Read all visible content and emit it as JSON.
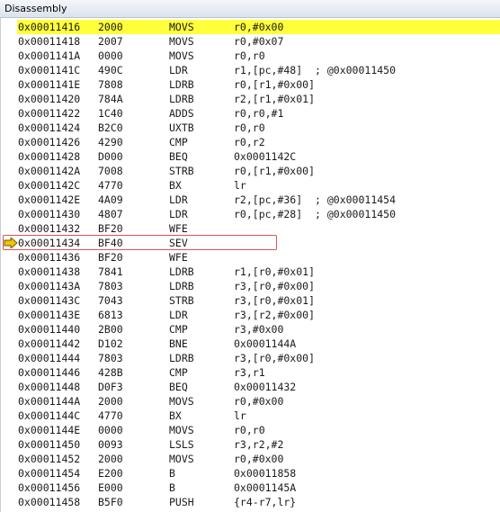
{
  "window": {
    "title": "Disassembly"
  },
  "colors": {
    "current_line_highlight": "#ffff3b",
    "current_instruction_box": "#e0505a",
    "execution_arrow": "#f2c400"
  },
  "current_instruction_icon": "yellow-arrow-icon",
  "rows": [
    {
      "addr": "0x00011416",
      "opcode": "2000",
      "mnemonic": "MOVS",
      "operands": "r0,#0x00"
    },
    {
      "addr": "0x00011418",
      "opcode": "2007",
      "mnemonic": "MOVS",
      "operands": "r0,#0x07"
    },
    {
      "addr": "0x0001141A",
      "opcode": "0000",
      "mnemonic": "MOVS",
      "operands": "r0,r0"
    },
    {
      "addr": "0x0001141C",
      "opcode": "490C",
      "mnemonic": "LDR",
      "operands": "r1,[pc,#48]  ; @0x00011450"
    },
    {
      "addr": "0x0001141E",
      "opcode": "7808",
      "mnemonic": "LDRB",
      "operands": "r0,[r1,#0x00]"
    },
    {
      "addr": "0x00011420",
      "opcode": "784A",
      "mnemonic": "LDRB",
      "operands": "r2,[r1,#0x01]"
    },
    {
      "addr": "0x00011422",
      "opcode": "1C40",
      "mnemonic": "ADDS",
      "operands": "r0,r0,#1"
    },
    {
      "addr": "0x00011424",
      "opcode": "B2C0",
      "mnemonic": "UXTB",
      "operands": "r0,r0"
    },
    {
      "addr": "0x00011426",
      "opcode": "4290",
      "mnemonic": "CMP",
      "operands": "r0,r2"
    },
    {
      "addr": "0x00011428",
      "opcode": "D000",
      "mnemonic": "BEQ",
      "operands": "0x0001142C"
    },
    {
      "addr": "0x0001142A",
      "opcode": "7008",
      "mnemonic": "STRB",
      "operands": "r0,[r1,#0x00]"
    },
    {
      "addr": "0x0001142C",
      "opcode": "4770",
      "mnemonic": "BX",
      "operands": "lr"
    },
    {
      "addr": "0x0001142E",
      "opcode": "4A09",
      "mnemonic": "LDR",
      "operands": "r2,[pc,#36]  ; @0x00011454"
    },
    {
      "addr": "0x00011430",
      "opcode": "4807",
      "mnemonic": "LDR",
      "operands": "r0,[pc,#28]  ; @0x00011450"
    },
    {
      "addr": "0x00011432",
      "opcode": "BF20",
      "mnemonic": "WFE",
      "operands": ""
    },
    {
      "addr": "0x00011434",
      "opcode": "BF40",
      "mnemonic": "SEV",
      "operands": ""
    },
    {
      "addr": "0x00011436",
      "opcode": "BF20",
      "mnemonic": "WFE",
      "operands": ""
    },
    {
      "addr": "0x00011438",
      "opcode": "7841",
      "mnemonic": "LDRB",
      "operands": "r1,[r0,#0x01]"
    },
    {
      "addr": "0x0001143A",
      "opcode": "7803",
      "mnemonic": "LDRB",
      "operands": "r3,[r0,#0x00]"
    },
    {
      "addr": "0x0001143C",
      "opcode": "7043",
      "mnemonic": "STRB",
      "operands": "r3,[r0,#0x01]"
    },
    {
      "addr": "0x0001143E",
      "opcode": "6813",
      "mnemonic": "LDR",
      "operands": "r3,[r2,#0x00]"
    },
    {
      "addr": "0x00011440",
      "opcode": "2B00",
      "mnemonic": "CMP",
      "operands": "r3,#0x00"
    },
    {
      "addr": "0x00011442",
      "opcode": "D102",
      "mnemonic": "BNE",
      "operands": "0x0001144A"
    },
    {
      "addr": "0x00011444",
      "opcode": "7803",
      "mnemonic": "LDRB",
      "operands": "r3,[r0,#0x00]"
    },
    {
      "addr": "0x00011446",
      "opcode": "428B",
      "mnemonic": "CMP",
      "operands": "r3,r1"
    },
    {
      "addr": "0x00011448",
      "opcode": "D0F3",
      "mnemonic": "BEQ",
      "operands": "0x00011432"
    },
    {
      "addr": "0x0001144A",
      "opcode": "2000",
      "mnemonic": "MOVS",
      "operands": "r0,#0x00"
    },
    {
      "addr": "0x0001144C",
      "opcode": "4770",
      "mnemonic": "BX",
      "operands": "lr"
    },
    {
      "addr": "0x0001144E",
      "opcode": "0000",
      "mnemonic": "MOVS",
      "operands": "r0,r0"
    },
    {
      "addr": "0x00011450",
      "opcode": "0093",
      "mnemonic": "LSLS",
      "operands": "r3,r2,#2"
    },
    {
      "addr": "0x00011452",
      "opcode": "2000",
      "mnemonic": "MOVS",
      "operands": "r0,#0x00"
    },
    {
      "addr": "0x00011454",
      "opcode": "E200",
      "mnemonic": "B",
      "operands": "0x00011858"
    },
    {
      "addr": "0x00011456",
      "opcode": "E000",
      "mnemonic": "B",
      "operands": "0x0001145A"
    },
    {
      "addr": "0x00011458",
      "opcode": "B5F0",
      "mnemonic": "PUSH",
      "operands": "{r4-r7,lr}"
    }
  ]
}
